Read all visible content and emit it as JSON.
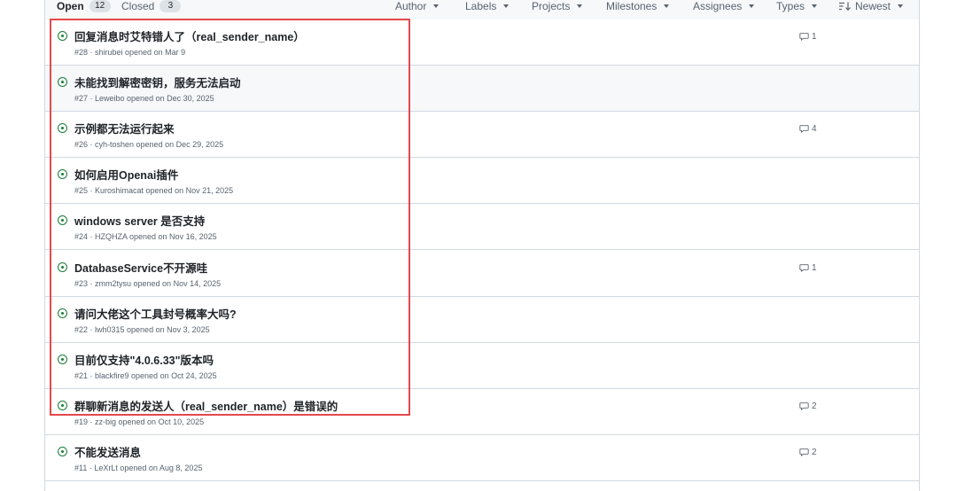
{
  "header": {
    "open_label": "Open",
    "open_count": "12",
    "closed_label": "Closed",
    "closed_count": "3",
    "filters": {
      "author": "Author",
      "labels": "Labels",
      "projects": "Projects",
      "milestones": "Milestones",
      "assignees": "Assignees",
      "types": "Types",
      "sort": "Newest"
    }
  },
  "issues": [
    {
      "title": "回复消息时艾特错人了（real_sender_name）",
      "meta": "#28 · shirubei opened on Mar 9",
      "comments": "1"
    },
    {
      "title": "未能找到解密密钥，服务无法启动",
      "meta": "#27 · Leweibo opened on Dec 30, 2025",
      "comments": ""
    },
    {
      "title": "示例都无法运行起来",
      "meta": "#26 · cyh-toshen opened on Dec 29, 2025",
      "comments": "4"
    },
    {
      "title": "如何启用Openai插件",
      "meta": "#25 · Kuroshimacat opened on Nov 21, 2025",
      "comments": ""
    },
    {
      "title": "windows server 是否支持",
      "meta": "#24 · HZQHZA opened on Nov 16, 2025",
      "comments": ""
    },
    {
      "title": "DatabaseService不开源哇",
      "meta": "#23 · zmm2tysu opened on Nov 14, 2025",
      "comments": "1"
    },
    {
      "title": "请问大佬这个工具封号概率大吗?",
      "meta": "#22 · lwh0315 opened on Nov 3, 2025",
      "comments": ""
    },
    {
      "title": "目前仅支持\"4.0.6.33\"版本吗",
      "meta": "#21 · blackfire9 opened on Oct 24, 2025",
      "comments": ""
    },
    {
      "title": "群聊新消息的发送人（real_sender_name）是错误的",
      "meta": "#19 · zz-big opened on Oct 10, 2025",
      "comments": "2"
    },
    {
      "title": "不能发送消息",
      "meta": "#11 · LeXrLt opened on Aug 8, 2025",
      "comments": "2"
    }
  ]
}
